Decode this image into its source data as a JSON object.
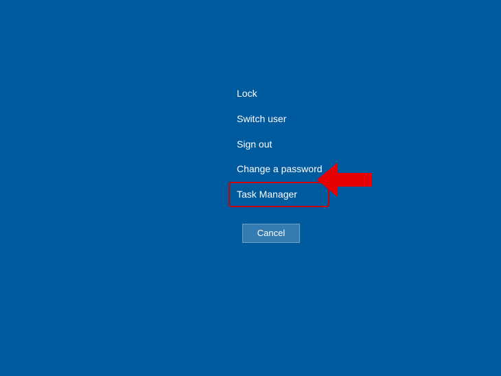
{
  "menu": {
    "items": [
      {
        "label": "Lock"
      },
      {
        "label": "Switch user"
      },
      {
        "label": "Sign out"
      },
      {
        "label": "Change a password"
      },
      {
        "label": "Task Manager"
      }
    ],
    "cancel_label": "Cancel"
  },
  "annotation": {
    "highlighted_index": 4,
    "arrow_color": "#e60000"
  }
}
